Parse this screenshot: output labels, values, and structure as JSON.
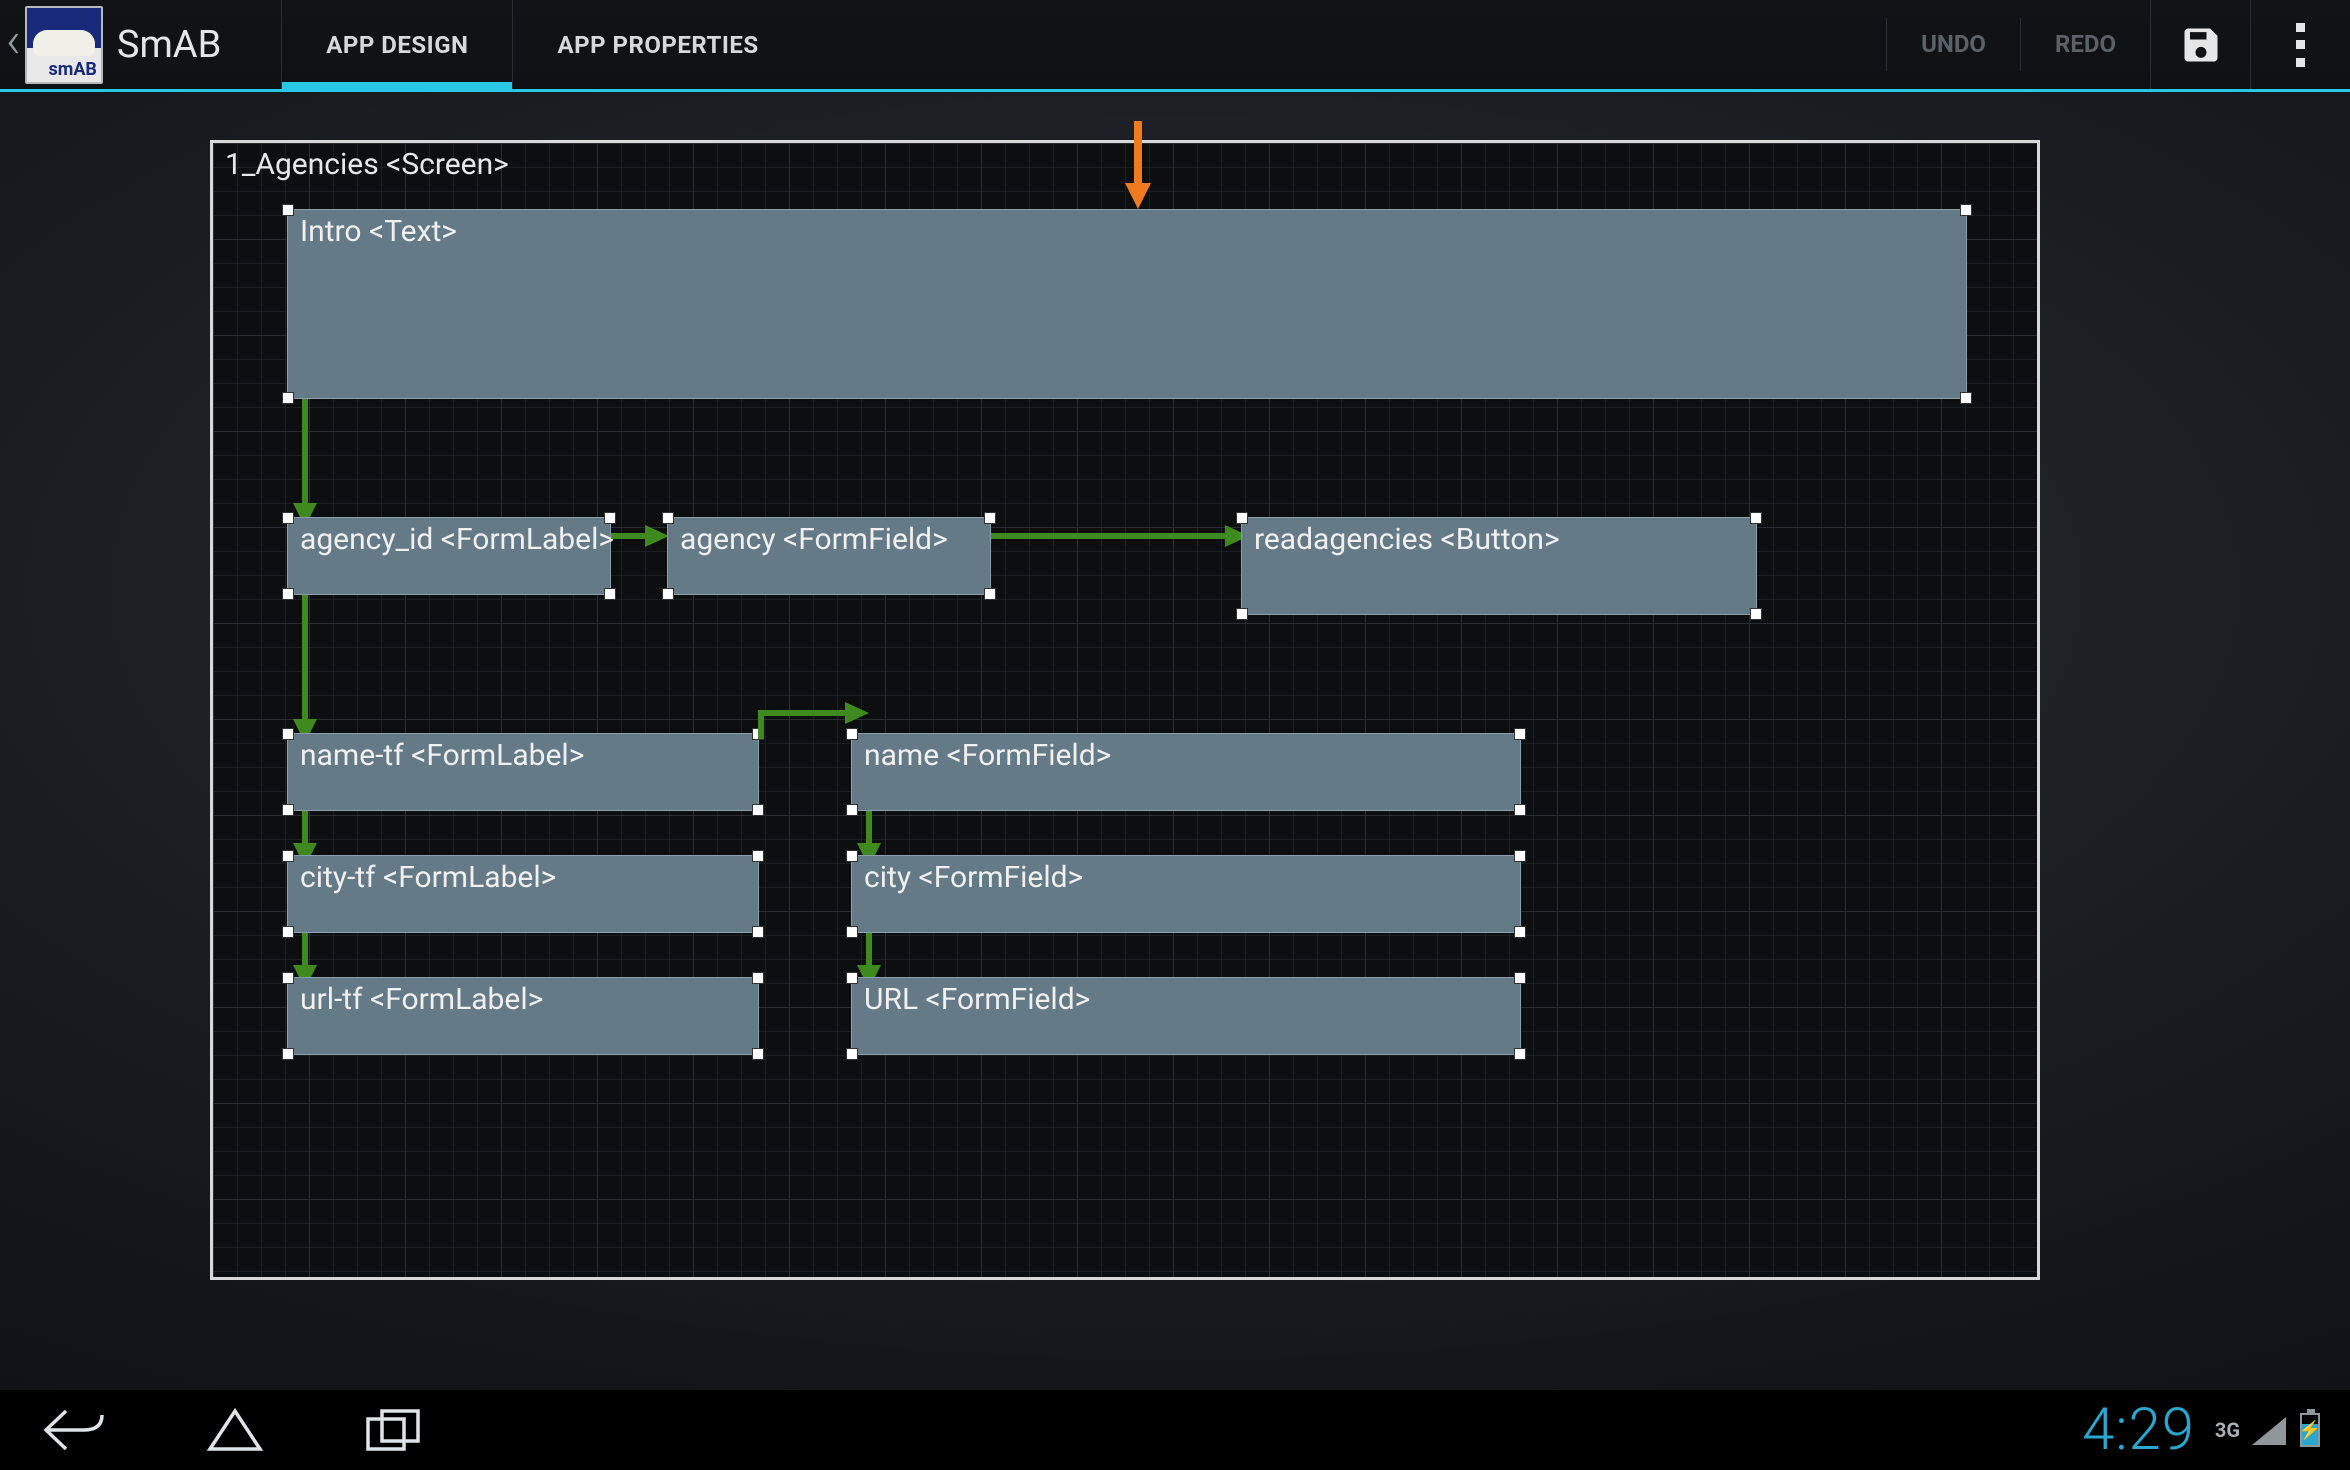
{
  "app": {
    "title": "SmAB",
    "icon_text": "smAB"
  },
  "tabs": {
    "design": "APP DESIGN",
    "properties": "APP PROPERTIES"
  },
  "actions": {
    "undo": "UNDO",
    "redo": "REDO"
  },
  "canvas": {
    "screen_label": "1_Agencies <Screen>",
    "nodes": {
      "intro": {
        "label": "Intro <Text>"
      },
      "agency_id": {
        "label": "agency_id <FormLabel>"
      },
      "agency": {
        "label": "agency <FormField>"
      },
      "readagencies": {
        "label": "readagencies <Button>"
      },
      "name_tf": {
        "label": "name-tf <FormLabel>"
      },
      "name": {
        "label": "name <FormField>"
      },
      "city_tf": {
        "label": "city-tf <FormLabel>"
      },
      "city": {
        "label": "city <FormField>"
      },
      "url_tf": {
        "label": "url-tf <FormLabel>"
      },
      "url": {
        "label": "URL <FormField>"
      }
    }
  },
  "status": {
    "time": "4:29",
    "network": "3G"
  }
}
